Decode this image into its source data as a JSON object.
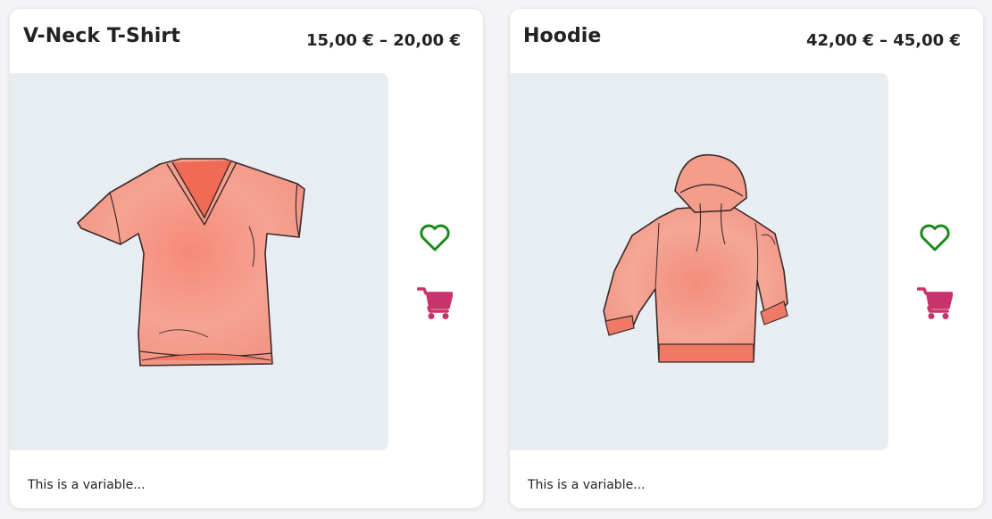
{
  "products": [
    {
      "title": "V-Neck T-Shirt",
      "price": "15,00 € – 20,00 €",
      "description": "This is a variable...",
      "image_icon": "v-neck-tshirt-illustration"
    },
    {
      "title": "Hoodie",
      "price": "42,00 € – 45,00 €",
      "description": "This is a variable...",
      "image_icon": "hoodie-illustration"
    }
  ],
  "colors": {
    "wishlist_heart": "#1a8a1a",
    "cart": "#c9336b",
    "garment": "#f4a08f",
    "image_bg": "#e8edf2"
  },
  "icons": {
    "wishlist": "heart-outline-icon",
    "cart": "shopping-cart-icon"
  }
}
